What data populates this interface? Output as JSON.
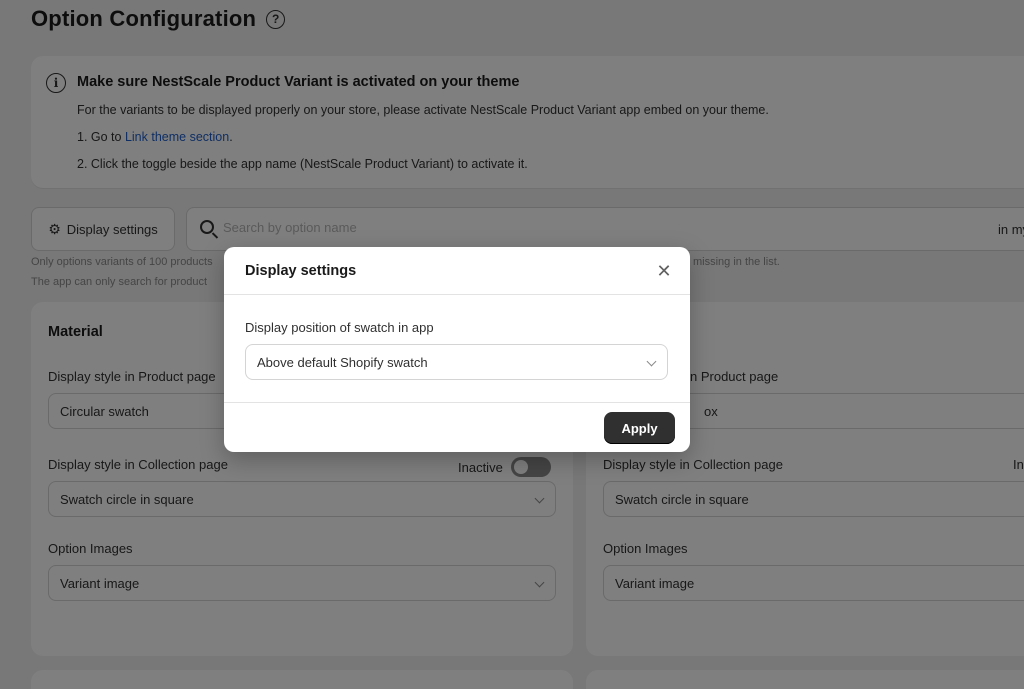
{
  "page": {
    "title": "Option Configuration",
    "help_icon": "question-circle-icon"
  },
  "banner": {
    "icon": "info-icon",
    "title": "Make sure NestScale Product Variant is activated on your theme",
    "line1": "For the variants to be displayed properly on your store, please activate NestScale Product Variant app embed on your theme.",
    "step1_prefix": "1. Go to ",
    "step1_link": "Link theme section",
    "step1_suffix": ".",
    "step2": "2. Click the toggle beside the app name (NestScale Product Variant) to activate it."
  },
  "toolbar": {
    "display_settings_label": "Display settings",
    "gear_icon": "gear-icon",
    "search_placeholder": "Search by option name",
    "search_icon": "search-icon",
    "search_suffix": "in my"
  },
  "hints": {
    "line1_left": "Only options variants of 100 products",
    "line1_right": "missing in the list.",
    "line2_left": "The app can only search for product"
  },
  "cards": [
    {
      "title": "Material",
      "product_label": "Display style in Product page",
      "product_value": "Circular swatch",
      "collection_label": "Display style in Collection page",
      "collection_status": "Inactive",
      "collection_value": "Swatch circle in square",
      "images_label": "Option Images",
      "images_value": "Variant image"
    },
    {
      "product_label_partial": "n Product page",
      "product_value_partial": "ox",
      "collection_label": "Display style in Collection page",
      "collection_status_partial": "In",
      "collection_value": "Swatch circle in square",
      "images_label": "Option Images",
      "images_value": "Variant image"
    }
  ],
  "modal": {
    "title": "Display settings",
    "close_icon": "close-icon",
    "field_label": "Display position of swatch in app",
    "field_value": "Above default Shopify swatch",
    "apply_label": "Apply"
  },
  "colors": {
    "page_bg": "#f1f1f1",
    "link": "#1f5fc9",
    "primary_button": "#303030",
    "overlay": "rgba(0,0,0,0.5)"
  }
}
